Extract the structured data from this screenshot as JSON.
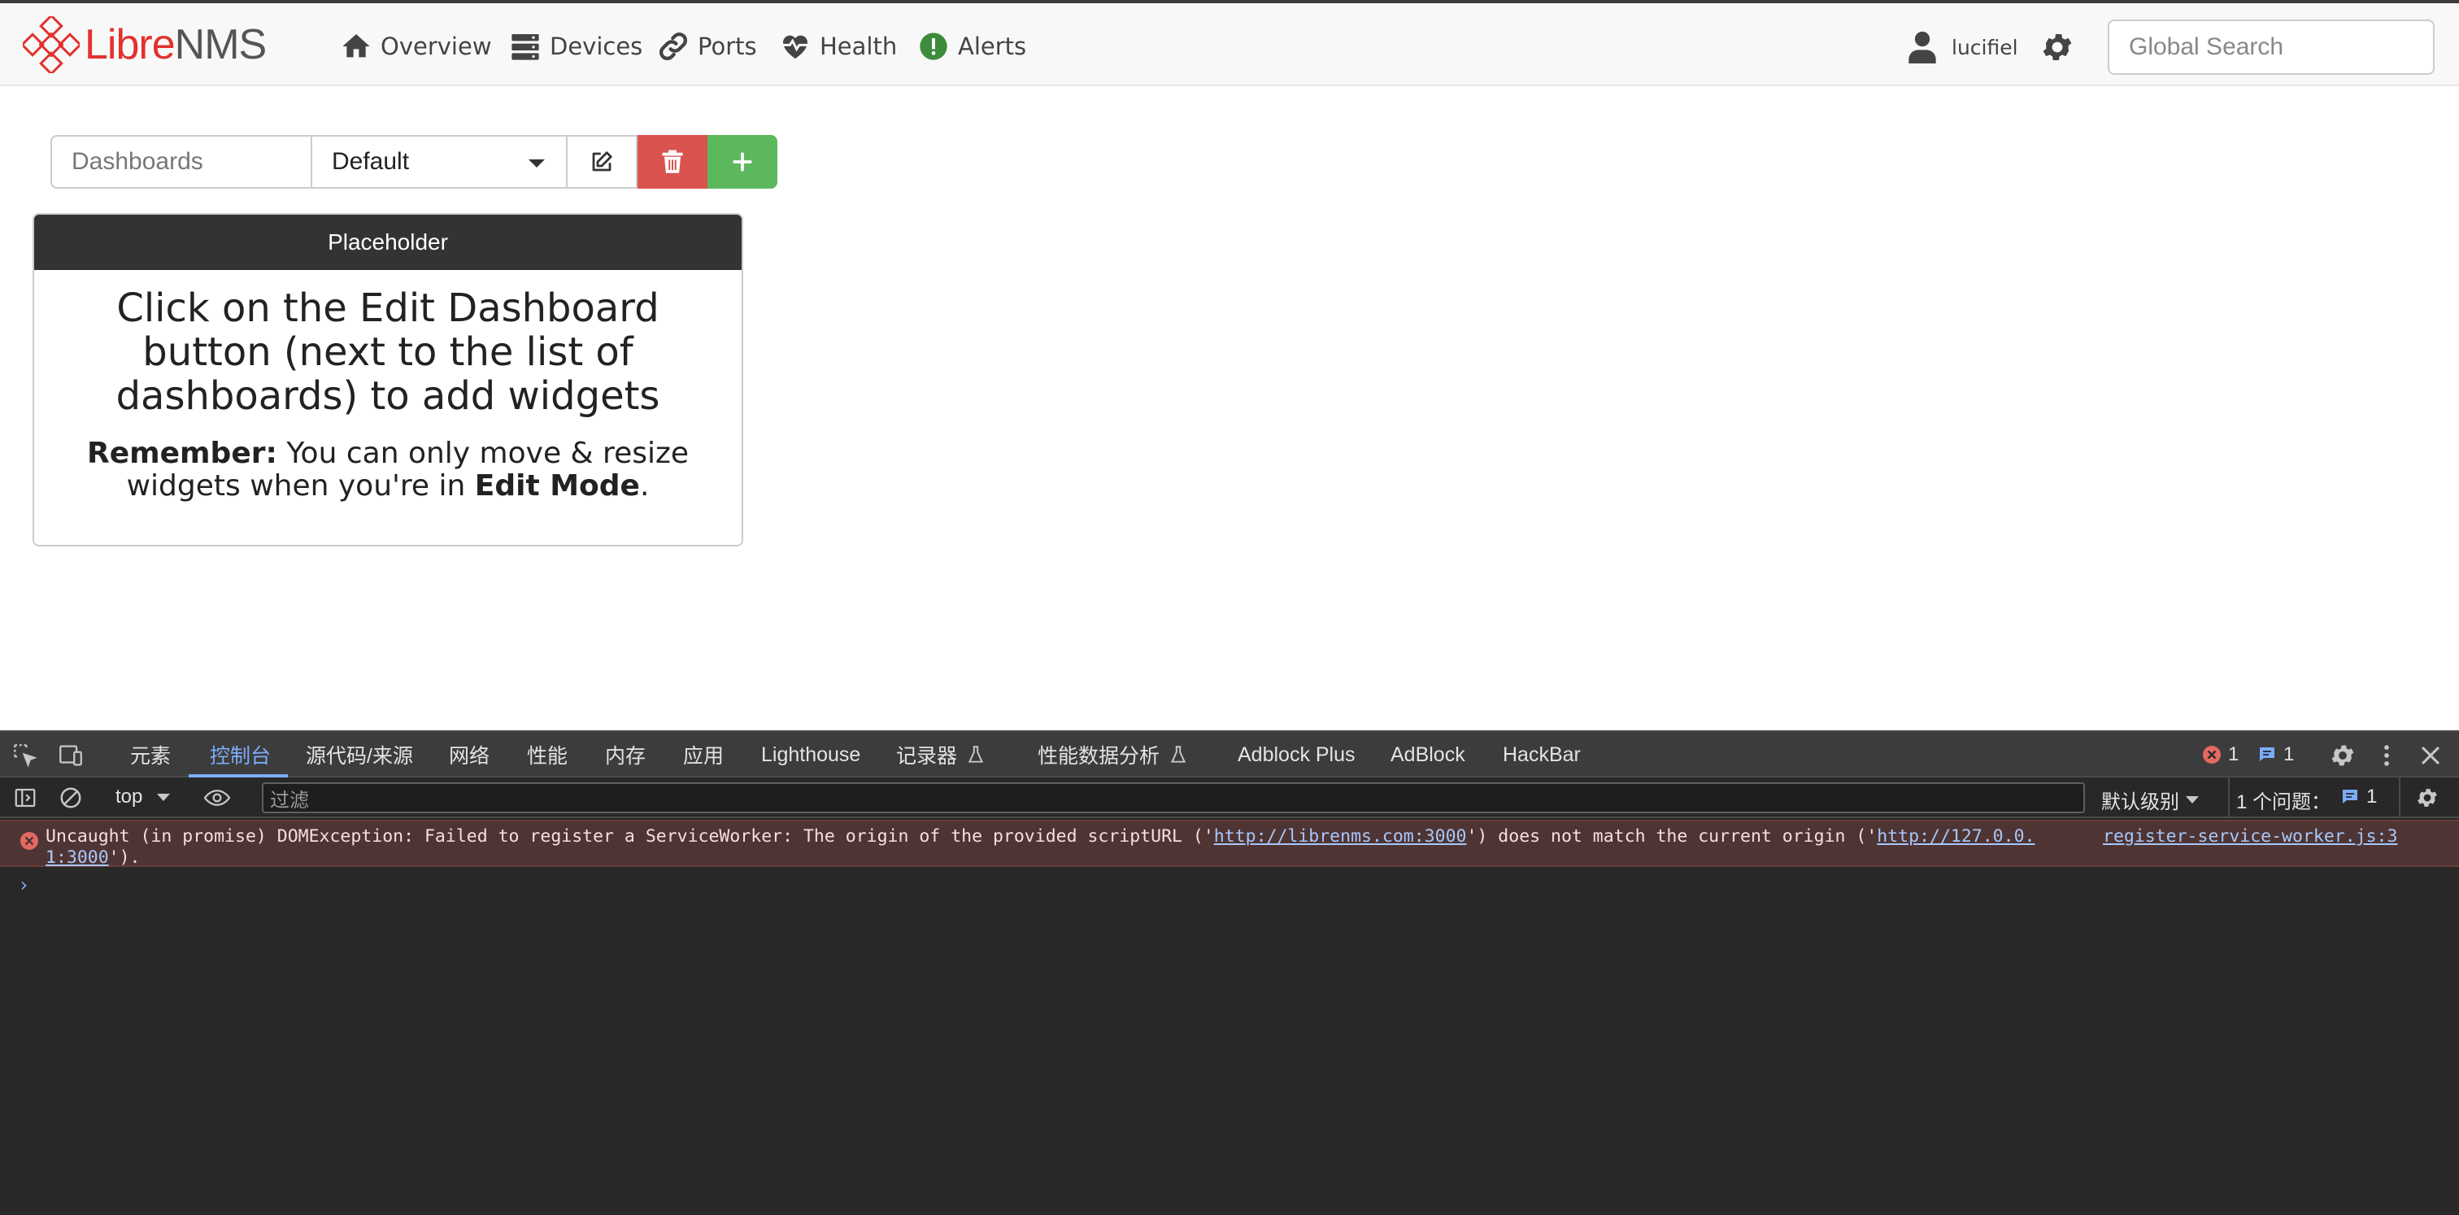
{
  "brand": {
    "libre": "Libre",
    "nms": "NMS",
    "accent": "#e2322f"
  },
  "nav": {
    "overview": "Overview",
    "devices": "Devices",
    "ports": "Ports",
    "health": "Health",
    "alerts": "Alerts",
    "user": "lucifiel",
    "search_placeholder": "Global Search"
  },
  "dashboard": {
    "label": "Dashboards",
    "selected": "Default",
    "delete_color": "#d9534f",
    "add_color": "#5cb85c"
  },
  "widget": {
    "title": "Placeholder",
    "heading": "Click on the Edit Dashboard button (next to the list of dashboards) to add widgets",
    "note_strong": "Remember:",
    "note_text": " You can only move & resize widgets when you're in ",
    "note_mode": "Edit Mode",
    "note_end": "."
  },
  "devtools": {
    "tabs": [
      "元素",
      "控制台",
      "源代码/来源",
      "网络",
      "性能",
      "内存",
      "应用",
      "Lighthouse",
      "记录器",
      "性能数据分析",
      "Adblock Plus",
      "AdBlock",
      "HackBar"
    ],
    "error_count": "1",
    "message_count": "1",
    "context": "top",
    "filter_placeholder": "过滤",
    "level": "默认级别",
    "issues_label": "1 个问题：",
    "issues_count": "1",
    "error": {
      "line1_prefix": "Uncaught (in promise) DOMException: Failed to register a ServiceWorker: The origin of the provided scriptURL ('",
      "url1": "http://librenms.com:3000",
      "line1_mid": "') does not match the current origin ('",
      "url2a": "http://127.0.0.",
      "url2b": "1:3000",
      "line2_end": "').",
      "source_a": "register-service-worker.js:3",
      "source_b": "1"
    },
    "prompt": "›"
  }
}
